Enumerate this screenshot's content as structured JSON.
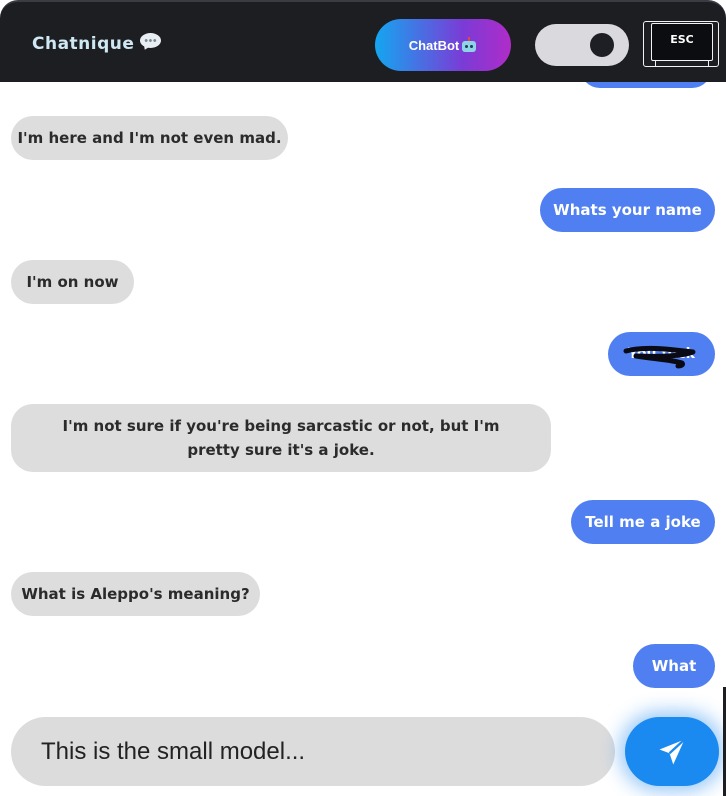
{
  "header": {
    "logo_text": "Chatnique",
    "logo_icon": "speech-bubble-icon",
    "chatbot_label": "ChatBot",
    "chatbot_icon": "robot-icon",
    "theme_toggle": "dark-mode-toggle",
    "esc_label": "ESC"
  },
  "messages": [
    {
      "sender": "bot",
      "text": "I'm here and I'm not even mad."
    },
    {
      "sender": "user",
      "text": "Whats your name"
    },
    {
      "sender": "bot",
      "text": "I'm on now"
    },
    {
      "sender": "user",
      "text": "You fuck",
      "redacted": true
    },
    {
      "sender": "bot",
      "text": "I'm not sure if you're being sarcastic or not, but I'm pretty sure it's a joke."
    },
    {
      "sender": "user",
      "text": "Tell me a joke"
    },
    {
      "sender": "bot",
      "text": "What is Aleppo's meaning?"
    },
    {
      "sender": "user",
      "text": "What"
    }
  ],
  "composer": {
    "placeholder": "This is the small model...",
    "value": "",
    "send_icon": "paper-plane-icon"
  },
  "colors": {
    "header_bg": "#1c1e22",
    "user_bubble": "#4f7ff0",
    "bot_bubble": "#dddddd",
    "send_button": "#1a8af0",
    "chatbot_gradient_start": "#14a6f0",
    "chatbot_gradient_end": "#b02cc8"
  }
}
